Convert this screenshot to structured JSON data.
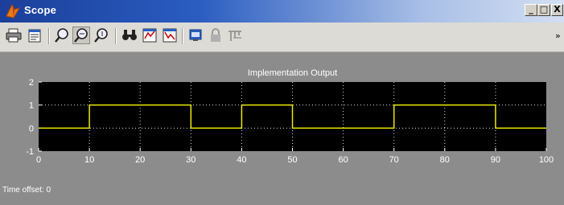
{
  "window": {
    "title": "Scope",
    "controls": [
      "_",
      "□",
      "X"
    ]
  },
  "toolbar": {
    "icons": [
      "print-icon",
      "parameters-icon",
      "zoom-icon",
      "zoom-x-icon",
      "zoom-y-icon",
      "autoscale-icon",
      "save-axes-icon",
      "restore-axes-icon",
      "floating-scope-icon",
      "lock-axes-icon",
      "signal-selection-icon"
    ],
    "selected_icon": "zoom-x-icon",
    "overflow": "»"
  },
  "status": {
    "time_offset_label": "Time offset:",
    "time_offset_value": "0"
  },
  "colors": {
    "background": "#8c8c8c",
    "axes_background": "#000000",
    "signal": "#e8e800",
    "grid": "#ffffff"
  },
  "chart_data": {
    "type": "line",
    "title": "Implementation Output",
    "xlabel": "",
    "ylabel": "",
    "xlim": [
      0,
      100
    ],
    "ylim": [
      -1,
      2
    ],
    "xticks": [
      0,
      10,
      20,
      30,
      40,
      50,
      60,
      70,
      80,
      90,
      100
    ],
    "yticks": [
      -1,
      0,
      1,
      2
    ],
    "grid": true,
    "series": [
      {
        "x": [
          0,
          10,
          10,
          30,
          30,
          40,
          40,
          50,
          50,
          70,
          70,
          90,
          90,
          100
        ],
        "y": [
          0,
          0,
          1,
          1,
          0,
          0,
          1,
          1,
          0,
          0,
          1,
          1,
          0,
          0
        ]
      }
    ]
  }
}
